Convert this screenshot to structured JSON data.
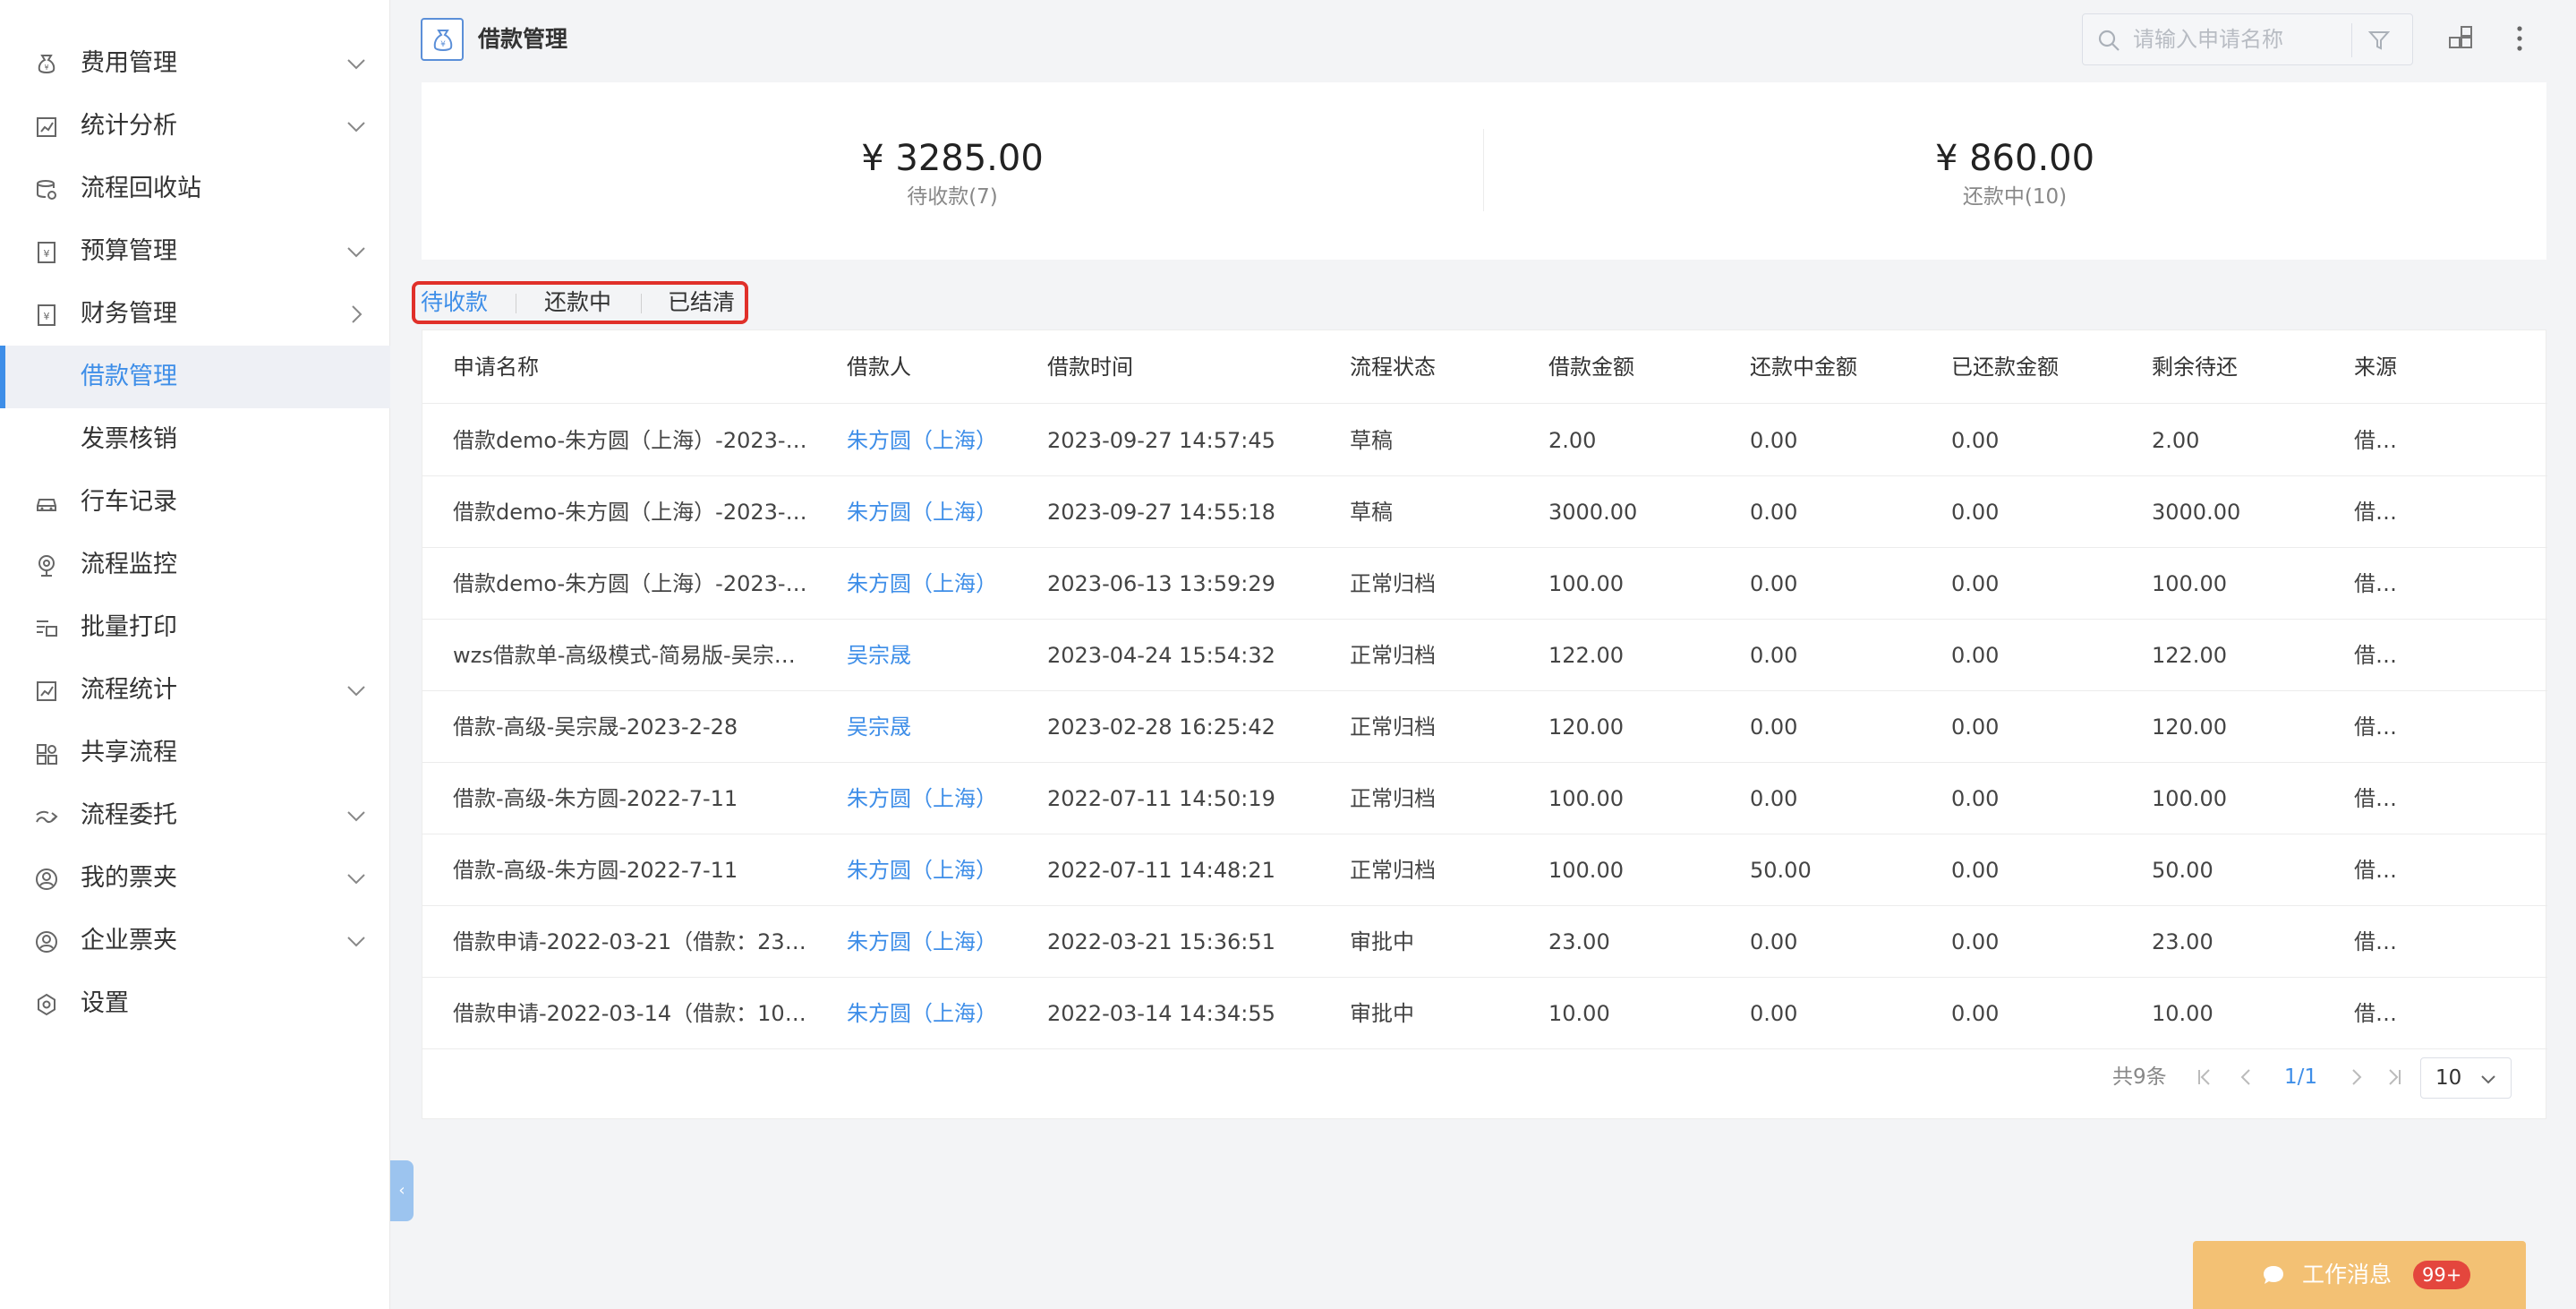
{
  "sidebar": {
    "items": [
      {
        "label": "费用管理",
        "icon": "expense-icon",
        "chevron": "down"
      },
      {
        "label": "统计分析",
        "icon": "chart-icon",
        "chevron": "down"
      },
      {
        "label": "流程回收站",
        "icon": "recycle-icon",
        "chevron": ""
      },
      {
        "label": "预算管理",
        "icon": "budget-icon",
        "chevron": "down"
      },
      {
        "label": "财务管理",
        "icon": "finance-icon",
        "chevron": "right"
      },
      {
        "label": "借款管理",
        "icon": "",
        "chevron": "",
        "active": true
      },
      {
        "label": "发票核销",
        "icon": "",
        "chevron": ""
      },
      {
        "label": "行车记录",
        "icon": "car-icon",
        "chevron": ""
      },
      {
        "label": "流程监控",
        "icon": "monitor-icon",
        "chevron": ""
      },
      {
        "label": "批量打印",
        "icon": "print-icon",
        "chevron": ""
      },
      {
        "label": "流程统计",
        "icon": "stats-icon",
        "chevron": "down"
      },
      {
        "label": "共享流程",
        "icon": "share-icon",
        "chevron": ""
      },
      {
        "label": "流程委托",
        "icon": "delegate-icon",
        "chevron": "down"
      },
      {
        "label": "我的票夹",
        "icon": "user-icon",
        "chevron": "down"
      },
      {
        "label": "企业票夹",
        "icon": "company-icon",
        "chevron": "down"
      },
      {
        "label": "设置",
        "icon": "settings-icon",
        "chevron": ""
      }
    ]
  },
  "header": {
    "title": "借款管理",
    "search_placeholder": "请输入申请名称"
  },
  "summary": {
    "pending": {
      "amount": "¥ 3285.00",
      "caption": "待收款(7)"
    },
    "repaying": {
      "amount": "¥ 860.00",
      "caption": "还款中(10)"
    }
  },
  "tabs": [
    {
      "label": "待收款",
      "active": true
    },
    {
      "label": "还款中",
      "active": false
    },
    {
      "label": "已结清",
      "active": false
    }
  ],
  "table": {
    "columns": [
      "申请名称",
      "借款人",
      "借款时间",
      "流程状态",
      "借款金额",
      "还款中金额",
      "已还款金额",
      "剩余待还",
      "来源"
    ],
    "rows": [
      [
        "借款demo-朱方圆（上海）-2023-…",
        "朱方圆（上海）",
        "2023-09-27 14:57:45",
        "草稿",
        "2.00",
        "0.00",
        "0.00",
        "2.00",
        "借…"
      ],
      [
        "借款demo-朱方圆（上海）-2023-…",
        "朱方圆（上海）",
        "2023-09-27 14:55:18",
        "草稿",
        "3000.00",
        "0.00",
        "0.00",
        "3000.00",
        "借…"
      ],
      [
        "借款demo-朱方圆（上海）-2023-…",
        "朱方圆（上海）",
        "2023-06-13 13:59:29",
        "正常归档",
        "100.00",
        "0.00",
        "0.00",
        "100.00",
        "借…"
      ],
      [
        "wzs借款单-高级模式-简易版-吴宗…",
        "吴宗晟",
        "2023-04-24 15:54:32",
        "正常归档",
        "122.00",
        "0.00",
        "0.00",
        "122.00",
        "借…"
      ],
      [
        "借款-高级-吴宗晟-2023-2-28",
        "吴宗晟",
        "2023-02-28 16:25:42",
        "正常归档",
        "120.00",
        "0.00",
        "0.00",
        "120.00",
        "借…"
      ],
      [
        "借款-高级-朱方圆-2022-7-11",
        "朱方圆（上海）",
        "2022-07-11 14:50:19",
        "正常归档",
        "100.00",
        "0.00",
        "0.00",
        "100.00",
        "借…"
      ],
      [
        "借款-高级-朱方圆-2022-7-11",
        "朱方圆（上海）",
        "2022-07-11 14:48:21",
        "正常归档",
        "100.00",
        "50.00",
        "0.00",
        "50.00",
        "借…"
      ],
      [
        "借款申请-2022-03-21（借款：23.…",
        "朱方圆（上海）",
        "2022-03-21 15:36:51",
        "审批中",
        "23.00",
        "0.00",
        "0.00",
        "23.00",
        "借…"
      ],
      [
        "借款申请-2022-03-14（借款：10.…",
        "朱方圆（上海）",
        "2022-03-14 14:34:55",
        "审批中",
        "10.00",
        "0.00",
        "0.00",
        "10.00",
        "借…"
      ]
    ]
  },
  "pager": {
    "total": "共9条",
    "page": "1/1",
    "page_size": "10"
  },
  "message_button": {
    "label": "工作消息",
    "badge": "99+"
  },
  "colors": {
    "accent": "#3e8ee8",
    "highlight_border": "#e0302a",
    "message_bg": "#f3c174",
    "badge_bg": "#e4463d"
  }
}
